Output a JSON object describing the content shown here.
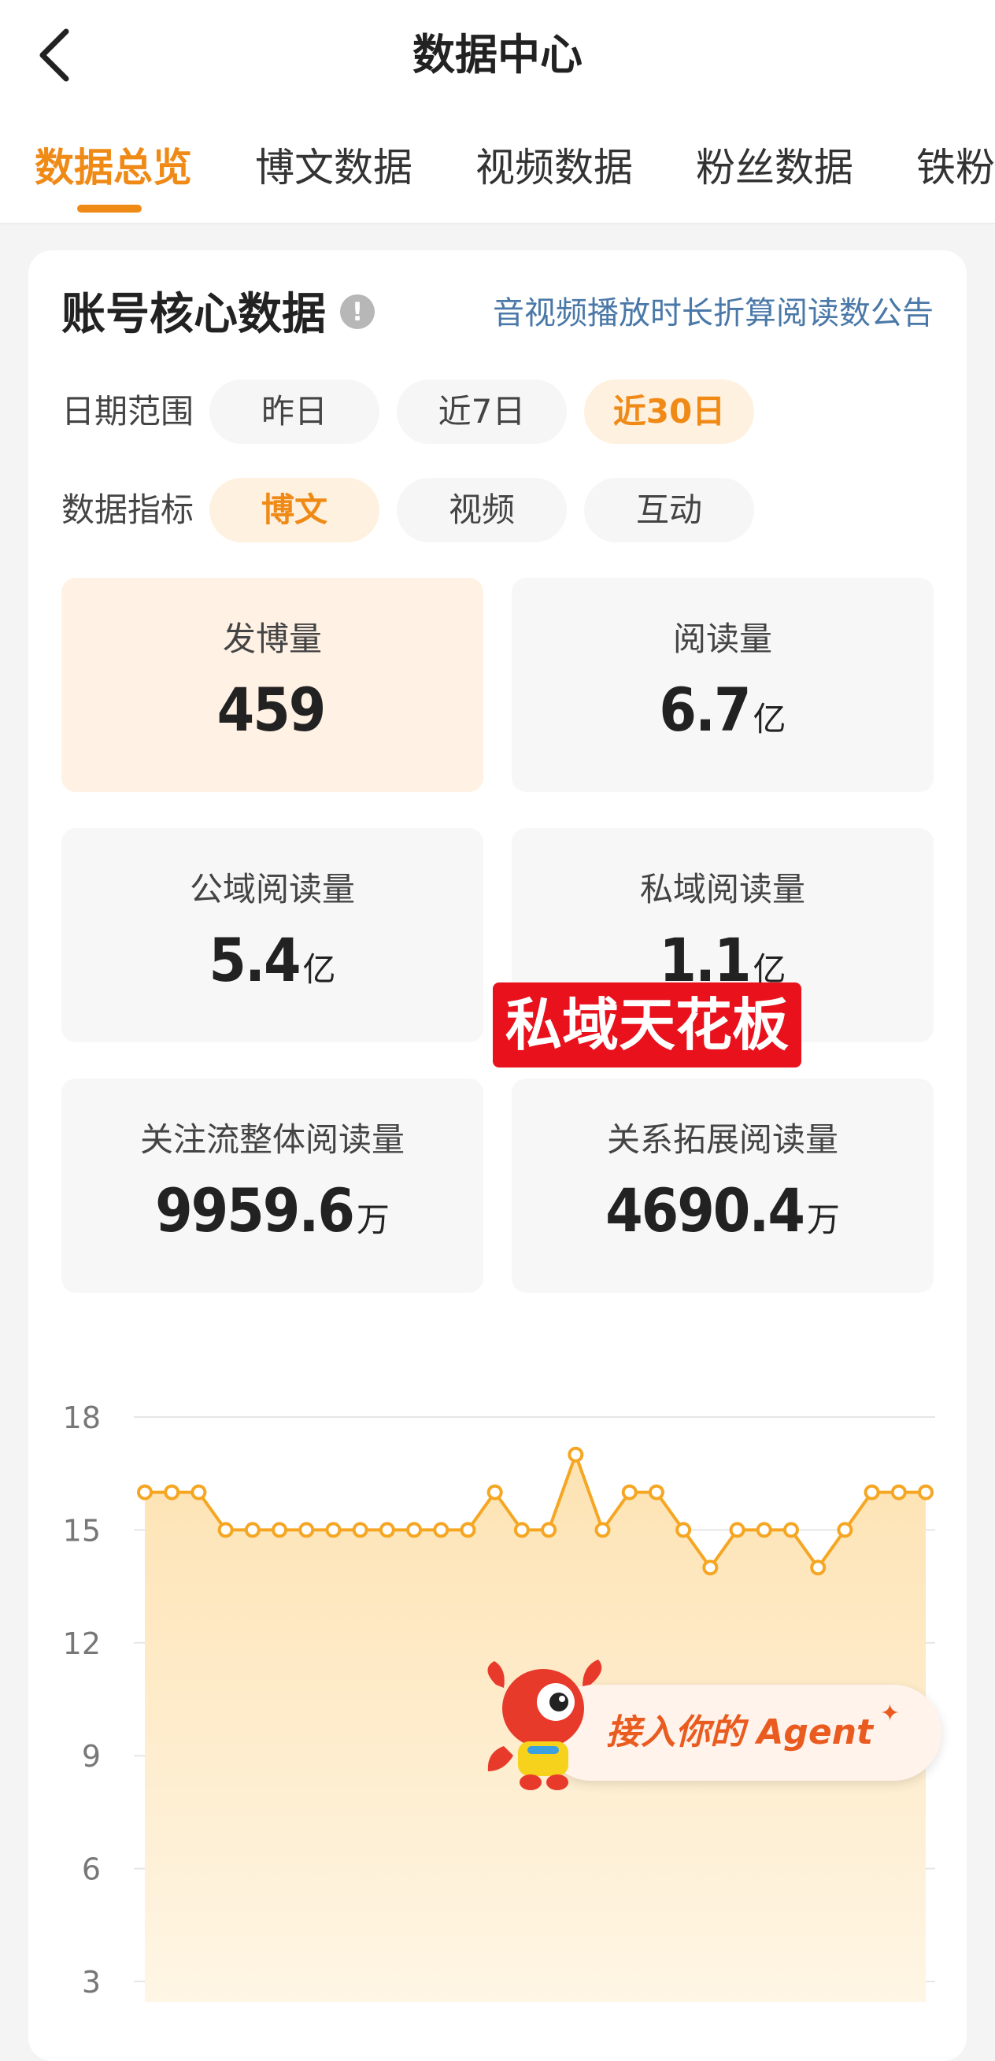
{
  "header": {
    "title": "数据中心"
  },
  "tabs": [
    "数据总览",
    "博文数据",
    "视频数据",
    "粉丝数据",
    "铁粉数据"
  ],
  "core": {
    "title": "账号核心数据",
    "info_icon": "!",
    "notice": "音视频播放时长折算阅读数公告"
  },
  "date_range": {
    "label": "日期范围",
    "options": [
      "昨日",
      "近7日",
      "近30日"
    ],
    "selected": "近30日"
  },
  "indicator": {
    "label": "数据指标",
    "options": [
      "博文",
      "视频",
      "互动"
    ],
    "selected": "博文"
  },
  "metrics": [
    {
      "label": "发博量",
      "value": "459",
      "unit": ""
    },
    {
      "label": "阅读量",
      "value": "6.7",
      "unit": "亿"
    },
    {
      "label": "公域阅读量",
      "value": "5.4",
      "unit": "亿"
    },
    {
      "label": "私域阅读量",
      "value": "1.1",
      "unit": "亿"
    },
    {
      "label": "关注流整体阅读量",
      "value": "9959.6",
      "unit": "万"
    },
    {
      "label": "关系拓展阅读量",
      "value": "4690.4",
      "unit": "万"
    }
  ],
  "overlay_tag": "私域天花板",
  "agent": {
    "label": "接入你的 Agent",
    "sparkle": "✦"
  },
  "chart_data": {
    "type": "line",
    "series": [
      {
        "values": [
          16,
          16,
          16,
          15,
          15,
          15,
          15,
          15,
          15,
          15,
          15,
          15,
          15,
          16,
          15,
          15,
          17,
          15,
          16,
          16,
          15,
          14,
          15,
          15,
          15,
          14,
          15,
          16,
          16,
          16
        ]
      }
    ],
    "yticks": [
      "18",
      "15",
      "12",
      "9",
      "6",
      "3"
    ],
    "ylim": [
      3,
      18
    ],
    "grid": true,
    "area_fill": true,
    "colors": {
      "line": "#f5a623",
      "fill": "#fdecc6"
    }
  },
  "colors": {
    "accent": "#f08a16",
    "link": "#4a78a8",
    "tag": "#e8111c"
  }
}
